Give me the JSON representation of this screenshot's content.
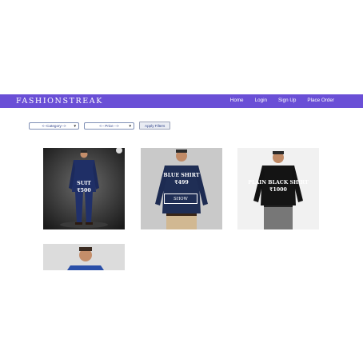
{
  "navbar": {
    "brand": "FASHIONSTREAK",
    "links": [
      "Home",
      "Login",
      "Sign Up",
      "Place Order"
    ]
  },
  "filters": {
    "category": "<--Category-->",
    "price": "<-- Price -->",
    "apply_label": "Apply Filters"
  },
  "products": [
    {
      "name": "SUIT",
      "price": "₹500"
    },
    {
      "name": "BLUE SHIRT",
      "price": "₹499",
      "button": "SHOW"
    },
    {
      "name": "PLAIN BLACK SHIRT",
      "price": "₹1000"
    }
  ],
  "colors": {
    "navbar": "#6a4fd6",
    "accent_text": "#2c3f88"
  }
}
